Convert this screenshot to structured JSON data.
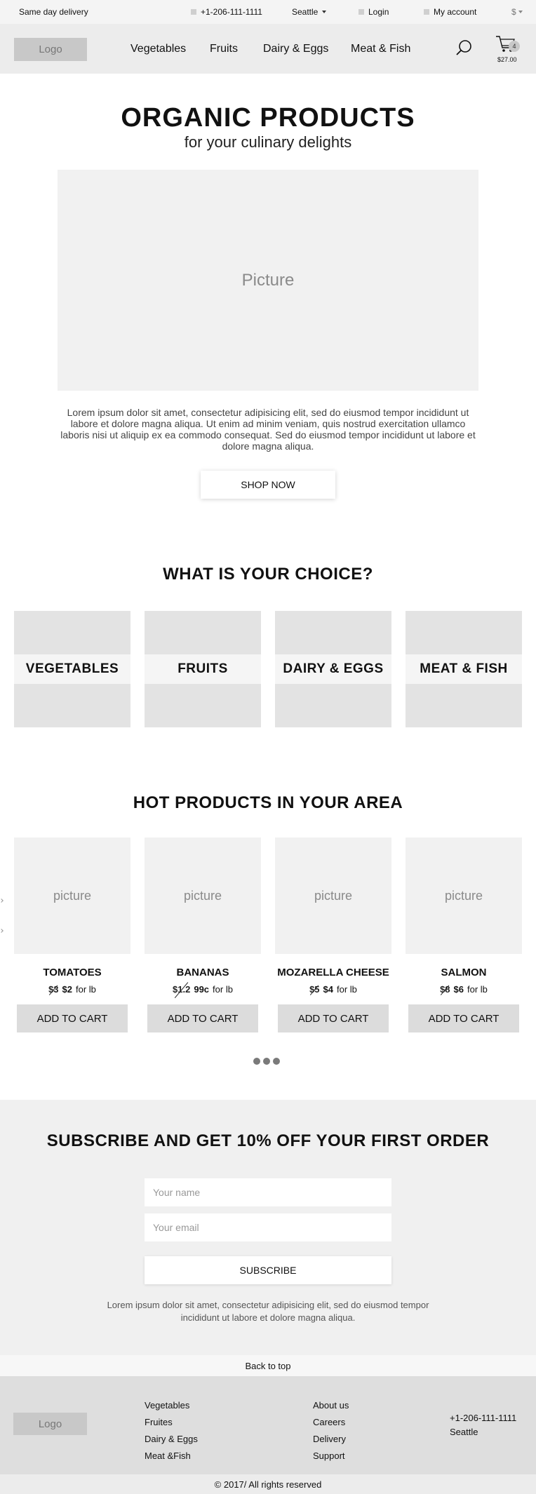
{
  "topbar": {
    "delivery": "Same day delivery",
    "phone": "+1-206-111-1111",
    "city": "Seattle",
    "login": "Login",
    "account": "My account",
    "currency": "$"
  },
  "header": {
    "logo": "Logo",
    "nav": [
      "Vegetables",
      "Fruits",
      "Dairy & Eggs",
      "Meat & Fish"
    ],
    "cart_count": "4",
    "cart_total": "$27.00"
  },
  "hero": {
    "title": "ORGANIC PRODUCTS",
    "subtitle": "for your culinary delights",
    "picture": "Picture",
    "text": "Lorem ipsum dolor sit amet, consectetur adipisicing elit, sed do eiusmod tempor incididunt ut labore et dolore magna aliqua. Ut enim ad minim veniam, quis nostrud exercitation ullamco laboris nisi ut aliquip ex ea commodo consequat. Sed do eiusmod tempor incididunt ut labore et dolore magna aliqua.",
    "button": "SHOP NOW"
  },
  "choice": {
    "title": "WHAT IS YOUR CHOICE?",
    "categories": [
      "VEGETABLES",
      "FRUITS",
      "DAIRY & EGGS",
      "MEAT & FISH"
    ]
  },
  "products": {
    "title": "HOT PRODUCTS IN YOUR AREA",
    "items": [
      {
        "picture": "picture",
        "name": "TOMATOES",
        "old_price": "$3",
        "new_price": "$2",
        "unit": "for lb",
        "button": "ADD TO CART"
      },
      {
        "picture": "picture",
        "name": "BANANAS",
        "old_price": "$1.2",
        "new_price": "99c",
        "unit": "for lb",
        "button": "ADD TO CART"
      },
      {
        "picture": "picture",
        "name": "MOZARELLA CHEESE",
        "old_price": "$5",
        "new_price": "$4",
        "unit": "for lb",
        "button": "ADD TO CART"
      },
      {
        "picture": "picture",
        "name": "SALMON",
        "old_price": "$8",
        "new_price": "$6",
        "unit": "for lb",
        "button": "ADD TO CART"
      }
    ]
  },
  "subscribe": {
    "title": "SUBSCRIBE AND GET 10% OFF YOUR FIRST ORDER",
    "name_placeholder": "Your name",
    "email_placeholder": "Your email",
    "button": "SUBSCRIBE",
    "note": "Lorem ipsum dolor sit amet, consectetur adipisicing elit, sed do eiusmod tempor incididunt ut labore et dolore magna aliqua."
  },
  "footer": {
    "back_to_top": "Back to top",
    "logo": "Logo",
    "col1": [
      "Vegetables",
      "Fruites",
      "Dairy & Eggs",
      "Meat &Fish"
    ],
    "col2": [
      "About us",
      "Careers",
      "Delivery",
      "Support"
    ],
    "phone": "+1-206-111-1111",
    "city": "Seattle",
    "copyright": "© 2017/ All rights reserved"
  }
}
